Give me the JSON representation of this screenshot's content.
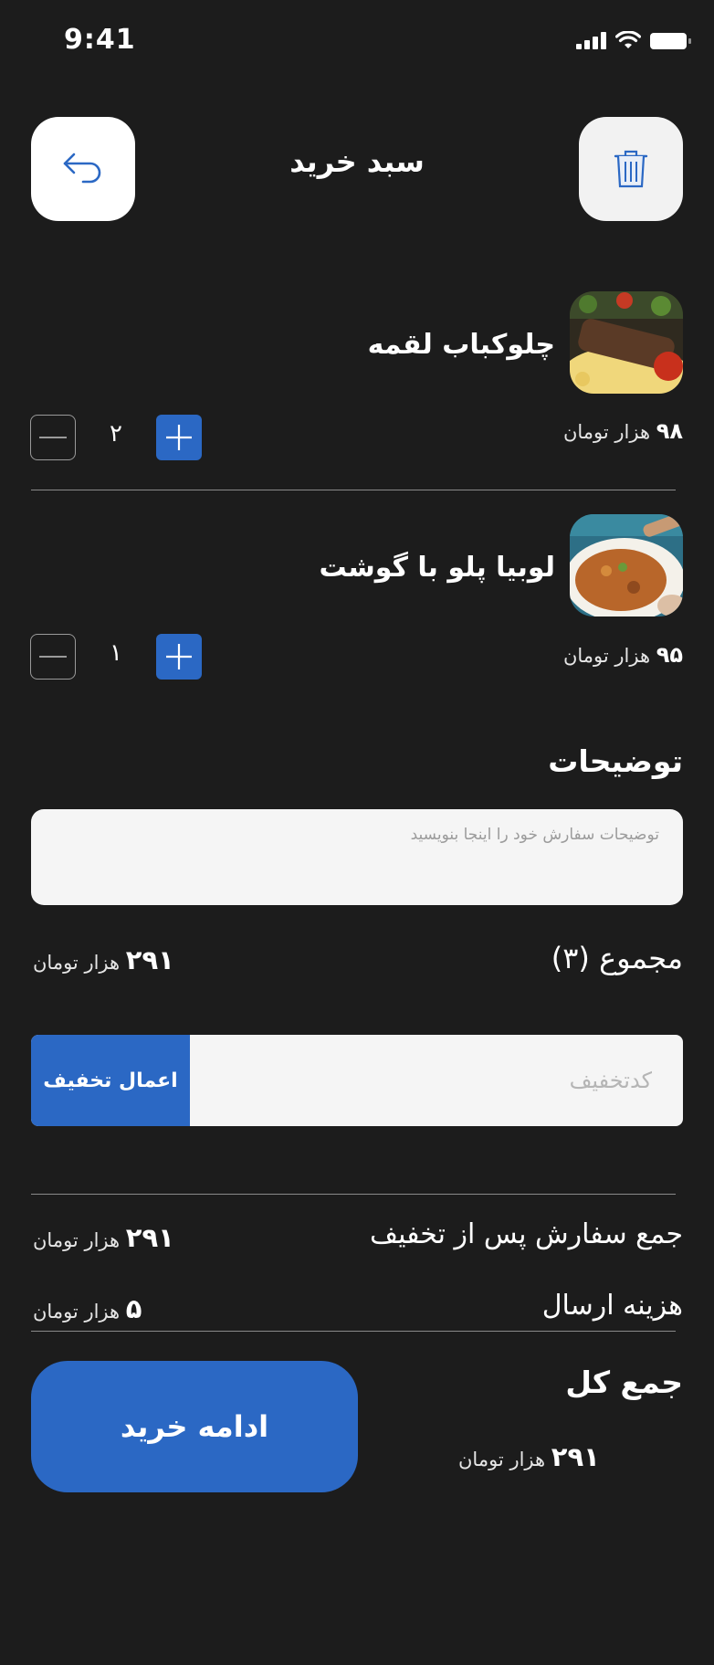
{
  "status_bar": {
    "time": "9:41"
  },
  "header": {
    "title": "سبد خرید"
  },
  "cart": {
    "items": [
      {
        "name": "چلوکباب لقمه",
        "price_value": "۹۸",
        "price_unit": "هزار تومان",
        "quantity": "۲"
      },
      {
        "name": "لوبیا پلو با گوشت",
        "price_value": "۹۵",
        "price_unit": "هزار تومان",
        "quantity": "۱"
      }
    ]
  },
  "description": {
    "title": "توضیحات",
    "placeholder": "توضیحات سفارش خود را اینجا بنویسید"
  },
  "subtotal": {
    "label": "مجموع (۳)",
    "value": "۲۹۱",
    "unit": "هزار تومان"
  },
  "discount": {
    "placeholder": "کدتخفیف",
    "apply_label": "اعمال تخفیف"
  },
  "after_discount": {
    "label": "جمع سفارش پس از تخفیف",
    "value": "۲۹۱",
    "unit": "هزار تومان"
  },
  "shipping": {
    "label": "هزینه ارسال",
    "value": "۵",
    "unit": "هزار تومان"
  },
  "total": {
    "label": "جمع کل",
    "value": "۲۹۱",
    "unit": "هزار تومان"
  },
  "continue_label": "ادامه خرید",
  "colors": {
    "background": "#1c1c1c",
    "accent": "#2b68c4"
  },
  "icons": {
    "back": "undo-arrow-icon",
    "trash": "trash-icon",
    "plus": "plus-icon",
    "minus": "minus-icon"
  }
}
